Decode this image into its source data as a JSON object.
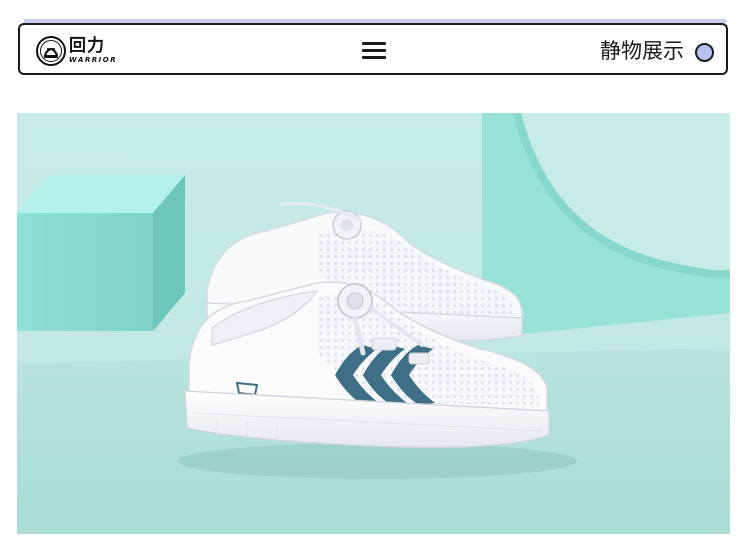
{
  "header": {
    "logo": {
      "brand_cn": "回力",
      "brand_en": "WARRIOR"
    },
    "menu_icon": "hamburger-menu-icon",
    "page_label": "静物展示",
    "indicator_color": "#b7c0ef"
  },
  "hero": {
    "image_subject": "product-photo",
    "colors": {
      "background": "#c8ede8",
      "accent_teal": "#3f6f86",
      "shoe_white": "#f8f8fb"
    }
  }
}
